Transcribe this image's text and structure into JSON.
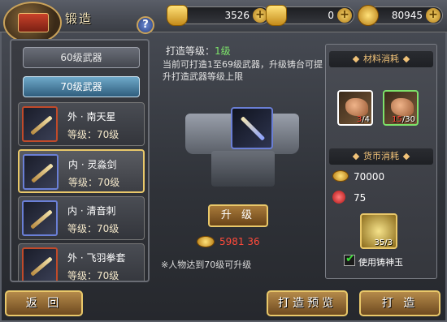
{
  "header": {
    "title": "锻造",
    "help_label": "?",
    "currencies": [
      {
        "icon": "gold-ingot-icon",
        "value": "3526",
        "plus": "+"
      },
      {
        "icon": "gold-bag-icon",
        "value": "0",
        "plus": "+"
      },
      {
        "icon": "coin-icon",
        "value": "80945",
        "plus": "+"
      }
    ]
  },
  "categories": [
    {
      "label": "60级武器"
    },
    {
      "label": "70级武器"
    }
  ],
  "weapons": [
    {
      "name": "外 · 南天星",
      "level": "等级：70级",
      "selected": false
    },
    {
      "name": "内 · 灵淼剑",
      "level": "等级：70级",
      "selected": true
    },
    {
      "name": "内 · 清音刺",
      "level": "等级：70级",
      "selected": false
    },
    {
      "name": "外 · 飞羽拳套",
      "level": "等级：70级",
      "selected": false
    }
  ],
  "forge": {
    "level_label": "打造等级：",
    "level_value": "1级",
    "description": "当前可打造1至69级武器，升级铸台可提升打造武器等级上限",
    "upgrade_label": "升 级",
    "cost_value": "5981 36",
    "note": "※人物达到70级可升级"
  },
  "materials": {
    "title": "材料消耗",
    "items": [
      {
        "icon": "ore-icon",
        "have": "3",
        "need": "/4"
      },
      {
        "icon": "ore-icon",
        "have": "15",
        "need": "/30"
      }
    ]
  },
  "currency_cost": {
    "title": "货币消耗",
    "coin": "70000",
    "orb": "75",
    "jade_count": "35/3",
    "use_jade_label": "使用铸神玉"
  },
  "buttons": {
    "back": "返 回",
    "preview": "打造预览",
    "forge": "打 造"
  },
  "colors": {
    "accent_gold": "#e9c86a",
    "level_green": "#7de26a",
    "cost_red": "#ff4a3a"
  }
}
